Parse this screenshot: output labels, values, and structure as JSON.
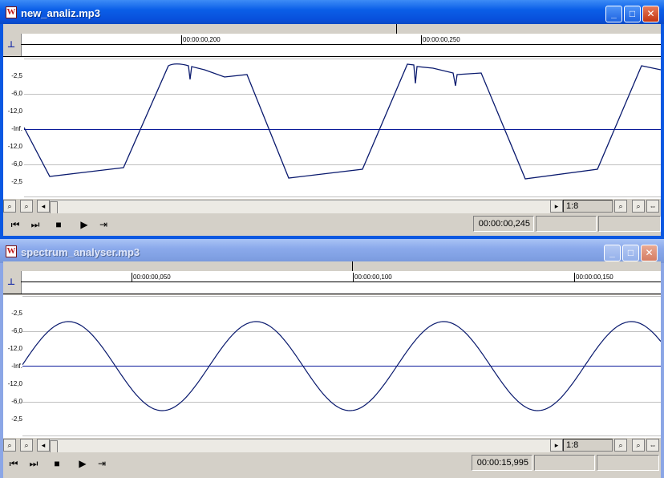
{
  "windows": [
    {
      "title": "new_analiz.mp3",
      "state": "active",
      "app_icon": "audio-file-icon",
      "ruler": {
        "labels": [
          "00:00:00,200",
          "00:00:00,250"
        ]
      },
      "y_axis_labels": [
        "-2,5",
        "-6,0",
        "-12,0",
        "-Inf.",
        "-12,0",
        "-6,0",
        "-2,5"
      ],
      "zoom_ratio": "1:8",
      "position": "00:00:00,245",
      "waveform": "clipped-square"
    },
    {
      "title": "spectrum_analyser.mp3",
      "state": "inactive",
      "app_icon": "audio-file-icon",
      "ruler": {
        "labels": [
          "00:00:00,050",
          "00:00:00,100",
          "00:00:00,150"
        ]
      },
      "y_axis_labels": [
        "-2,5",
        "-6,0",
        "-12,0",
        "-Inf.",
        "-12,0",
        "-6,0",
        "-2,5"
      ],
      "zoom_ratio": "1:8",
      "position": "00:00:15,995",
      "waveform": "sine"
    }
  ],
  "caption_buttons": {
    "minimize": "_",
    "maximize": "□",
    "close": "✕"
  },
  "transport_icons": [
    "go-to-start-icon",
    "go-to-end-icon",
    "stop-icon",
    "play-icon",
    "loop-icon"
  ],
  "colors": {
    "waveform": "#0a1a6e",
    "centerline": "#0a1a9a",
    "grid": "#c0c0c0",
    "active_title": "#0a58e2",
    "inactive_title": "#8ba6e6"
  }
}
